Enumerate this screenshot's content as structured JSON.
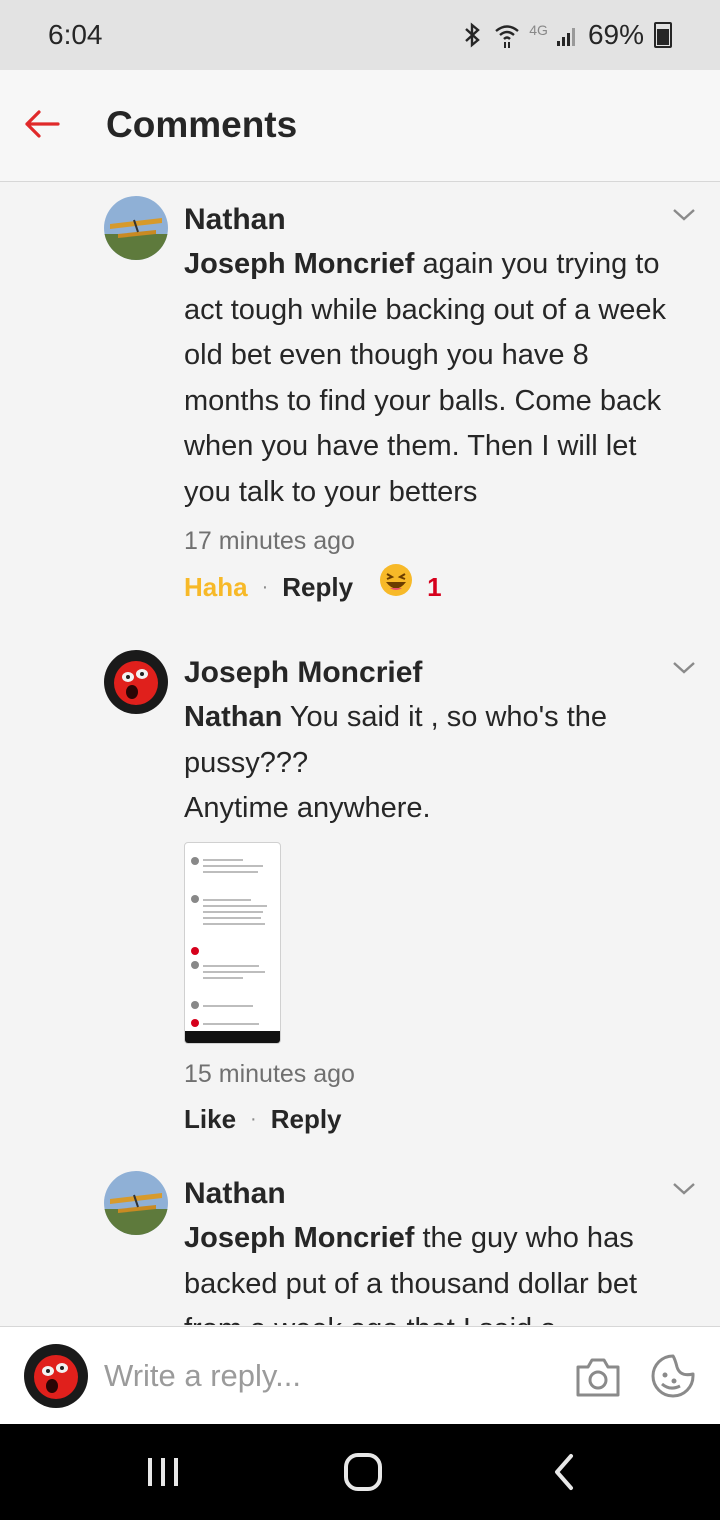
{
  "status_bar": {
    "time": "6:04",
    "network": "4G",
    "battery": "69%"
  },
  "header": {
    "title": "Comments"
  },
  "comments": [
    {
      "author": "Nathan",
      "mention": "Joseph Moncrief",
      "text": " again you trying to act tough while backing out of a week old bet even though you have 8 months to find your balls. Come back when you have them. Then I will let you talk to your betters",
      "time": "17 minutes ago",
      "action_label": "Haha",
      "reply_label": "Reply",
      "reaction_emoji": "😆",
      "reaction_count": "1"
    },
    {
      "author": "Joseph Moncrief",
      "mention": "Nathan",
      "text_line1": " You said it , so who's the pussy???",
      "text_line2": "Anytime anywhere.",
      "time": "15 minutes ago",
      "action_label": "Like",
      "reply_label": "Reply"
    },
    {
      "author": "Nathan",
      "mention": "Joseph Moncrief",
      "text": " the guy who has backed put of a thousand dollar bet from a week ago that I said a"
    }
  ],
  "reply_bar": {
    "placeholder": "Write a reply..."
  },
  "colors": {
    "accent_red": "#e0292a",
    "haha_yellow": "#f7b928",
    "reaction_count_red": "#d6001c"
  },
  "icons": [
    "back-arrow-icon",
    "chevron-down-icon",
    "camera-icon",
    "sticker-icon",
    "recent-apps-icon",
    "home-icon",
    "back-nav-icon"
  ]
}
